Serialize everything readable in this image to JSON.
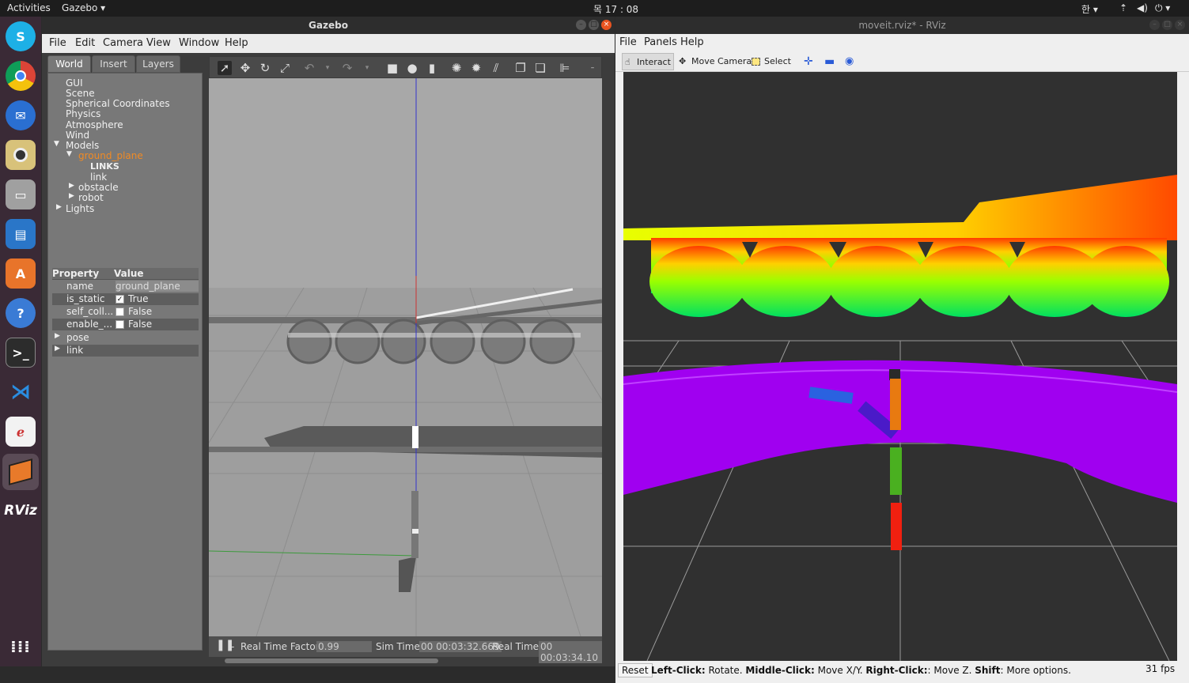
{
  "topbar": {
    "activities": "Activities",
    "app_menu": "Gazebo ▾",
    "clock": "목 17 : 08",
    "lang": "한 ▾"
  },
  "dock": {
    "items": [
      "skype",
      "chrome",
      "thunderbird",
      "rhythmbox",
      "files",
      "writer",
      "software",
      "help",
      "terminal",
      "vscode",
      "text-editor",
      "gazebo",
      "rviz",
      "show-apps"
    ]
  },
  "gazebo": {
    "title": "Gazebo",
    "menu": [
      "File",
      "Edit",
      "Camera",
      "View",
      "Window",
      "Help"
    ],
    "tabs": [
      "World",
      "Insert",
      "Layers"
    ],
    "tree": {
      "gui": "GUI",
      "scene": "Scene",
      "spherical": "Spherical Coordinates",
      "physics": "Physics",
      "atmosphere": "Atmosphere",
      "wind": "Wind",
      "models": "Models",
      "ground_plane": "ground_plane",
      "links": "LINKS",
      "link": "link",
      "obstacle": "obstacle",
      "robot": "robot",
      "lights": "Lights"
    },
    "properties": {
      "header_property": "Property",
      "header_value": "Value",
      "rows": [
        {
          "k": "name",
          "v": "ground_plane"
        },
        {
          "k": "is_static",
          "v": "True",
          "check": "✓"
        },
        {
          "k": "self_coll...",
          "v": "False"
        },
        {
          "k": "enable_...",
          "v": "False"
        }
      ],
      "pose": "pose",
      "link": "link"
    },
    "status": {
      "rtf_label": "Real Time Factor:",
      "rtf_value": "0.99",
      "sim_label": "Sim Time:",
      "sim_value": "00 00:03:32.669",
      "real_label": "Real Time:",
      "real_value": "00 00:03:34.10"
    }
  },
  "rviz": {
    "title": "moveit.rviz* - RViz",
    "menu": [
      "File",
      "Panels",
      "Help"
    ],
    "tools": [
      "Interact",
      "Move Camera",
      "Select"
    ],
    "status": {
      "reset": "Reset",
      "l1": "Left-Click:",
      "t1": " Rotate. ",
      "l2": "Middle-Click:",
      "t2": " Move X/Y. ",
      "l3": "Right-Click:",
      "t3": ": Move Z. ",
      "l4": "Shift",
      "t4": ": More options.",
      "fps": "31 fps"
    }
  },
  "colors": {
    "rviz_bg": "#303030",
    "gazebo_sky": "#a8a8a8",
    "accent_orange": "#f08a24"
  }
}
